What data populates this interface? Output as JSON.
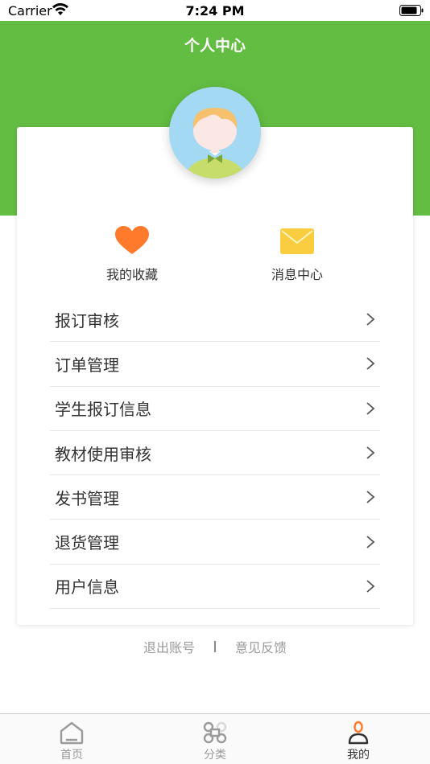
{
  "status_bar": {
    "carrier": "Carrier",
    "time": "7:24 PM"
  },
  "header": {
    "title": "个人中心"
  },
  "quick_actions": [
    {
      "label": "我的收藏",
      "icon": "heart-icon",
      "color": "#ff7a2b"
    },
    {
      "label": "消息中心",
      "icon": "envelope-icon",
      "color": "#f9cd3f"
    }
  ],
  "menu": [
    {
      "label": "报订审核"
    },
    {
      "label": "订单管理"
    },
    {
      "label": "学生报订信息"
    },
    {
      "label": "教材使用审核"
    },
    {
      "label": "发书管理"
    },
    {
      "label": "退货管理"
    },
    {
      "label": "用户信息"
    }
  ],
  "footer": {
    "logout": "退出账号",
    "feedback": "意见反馈"
  },
  "tabs": [
    {
      "label": "首页",
      "icon": "home-icon"
    },
    {
      "label": "分类",
      "icon": "command-icon"
    },
    {
      "label": "我的",
      "icon": "person-icon",
      "active": true
    }
  ],
  "colors": {
    "brand_green": "#62bd42",
    "accent_orange": "#ff7a2b"
  }
}
